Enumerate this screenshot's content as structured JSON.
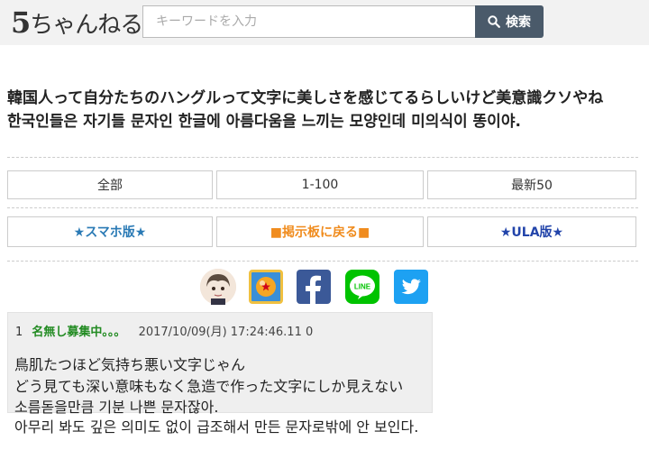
{
  "header": {
    "logo_text": "ちゃんねる",
    "logo_number": "5",
    "search_placeholder": "キーワードを入力",
    "search_button_label": "検索"
  },
  "thread": {
    "title_jp": "韓国人って自分たちのハングルって文字に美しさを感じてるらしいけど美意識クソやね",
    "title_kr": "한국인들은 자기들 문자인 한글에 아름다움을 느끼는 모양인데 미의식이 똥이야."
  },
  "nav": {
    "all": "全部",
    "range": "1-100",
    "latest": "最新50",
    "smartphone": "★スマホ版★",
    "back_to_board": "■掲示板に戻る■",
    "ula": "★ULA版★"
  },
  "post": {
    "number": "1",
    "name": "名無し募集中。。。",
    "date": "2017/10/09(月) 17:24:46.11",
    "id": "0",
    "line1": "鳥肌たつほど気持ち悪い文字じゃん",
    "line2": "どう見ても深い意味もなく急造で作った文字にしか見えない",
    "line3": "소름돋을만큼 기분 나쁜 문자잖아.",
    "line4": "아무리 봐도 깊은 의미도 없이 급조해서 만든 문자로밖에 안 보인다."
  },
  "colors": {
    "search_button": "#4a5a6a",
    "poster_name": "#228b22",
    "smartphone_link": "#2a7ab5",
    "board_link": "#f08c1e",
    "ula_link": "#2244aa",
    "facebook": "#3b5998",
    "line": "#00c300",
    "twitter": "#1da1f2"
  },
  "icons": [
    "search-icon",
    "avatar-icon",
    "dragon-ball-icon",
    "facebook-icon",
    "line-icon",
    "twitter-icon"
  ]
}
